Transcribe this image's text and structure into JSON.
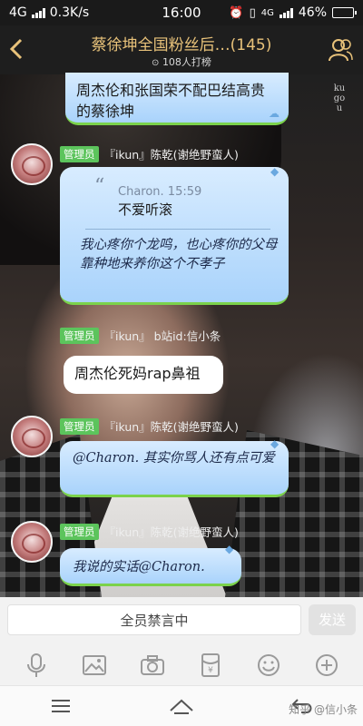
{
  "status_bar": {
    "network": "4G",
    "speed": "0.3K/s",
    "time": "16:00",
    "network_right": "4G",
    "battery": "46%",
    "battery_level": 0.46
  },
  "header": {
    "title": "蔡徐坤全国粉丝后…(145)",
    "subtitle": "108人打榜"
  },
  "messages": [
    {
      "text": "周杰伦和张国荣不配巴结高贵的蔡徐坤"
    },
    {
      "badge": "管理员",
      "sender": "『ikun』陈乾(谢绝野蛮人)",
      "quote_meta": "Charon. 15:59",
      "quote_text": "不爱听滚",
      "text": "我心疼你个龙鸣，也心疼你的父母靠种地来养你这个不孝子"
    },
    {
      "badge": "管理员",
      "sender": "『ikun』 b站id:信小条",
      "text": "周杰伦死妈rap鼻祖"
    },
    {
      "badge": "管理员",
      "sender": "『ikun』陈乾(谢绝野蛮人)",
      "text": "@Charon. 其实你骂人还有点可爱"
    },
    {
      "badge": "管理员",
      "sender": "『ikun』陈乾(谢绝野蛮人)",
      "text": "我说的实话@Charon."
    }
  ],
  "input": {
    "placeholder": "全员禁言中",
    "send_label": "发送"
  },
  "toolbar": [
    "microphone-icon",
    "image-icon",
    "camera-icon",
    "red-packet-icon",
    "emoji-icon",
    "plus-icon"
  ],
  "nav": [
    "menu-icon",
    "home-icon",
    "back-icon"
  ],
  "watermark": "知乎 @信小条",
  "backdrop_text": "kugou"
}
